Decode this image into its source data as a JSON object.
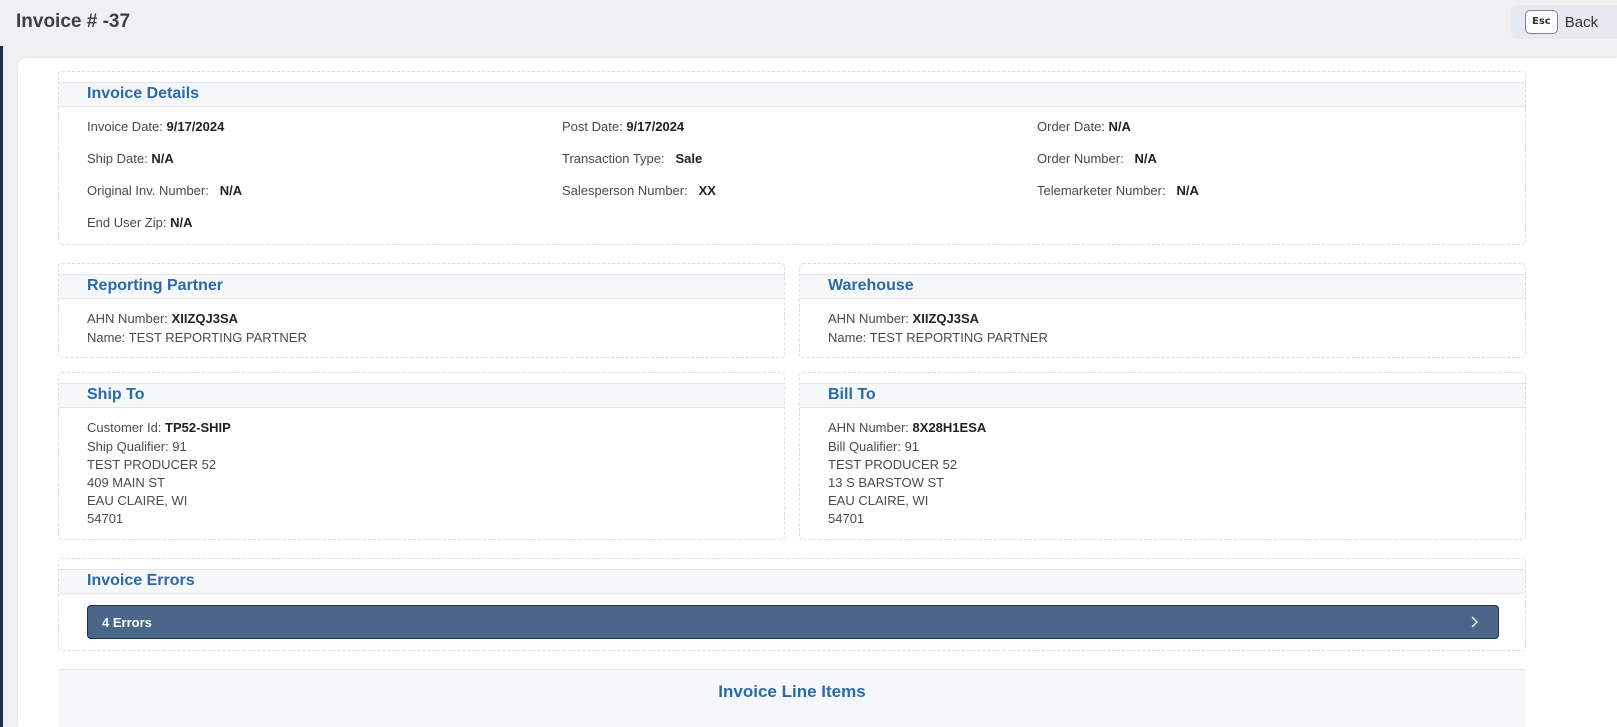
{
  "header": {
    "title": "Invoice # -37",
    "back_key": "Esc",
    "back_label": "Back"
  },
  "invoice_details": {
    "title": "Invoice Details",
    "fields": [
      {
        "label": "Invoice Date:",
        "value": "9/17/2024"
      },
      {
        "label": "Post Date:",
        "value": "9/17/2024"
      },
      {
        "label": "Order Date:",
        "value": "N/A"
      },
      {
        "label": "Ship Date:",
        "value": "N/A"
      },
      {
        "label": "Transaction Type:",
        "value": "Sale"
      },
      {
        "label": "Order Number:",
        "value": "N/A"
      },
      {
        "label": "Original Inv. Number:",
        "value": "N/A"
      },
      {
        "label": "Salesperson Number:",
        "value": "XX"
      },
      {
        "label": "Telemarketer Number:",
        "value": "N/A"
      },
      {
        "label": "End User Zip:",
        "value": "N/A"
      }
    ]
  },
  "reporting_partner": {
    "title": "Reporting Partner",
    "ahn_label": "AHN Number:",
    "ahn_value": "XIIZQJ3SA",
    "name_line": "Name: TEST REPORTING PARTNER"
  },
  "warehouse": {
    "title": "Warehouse",
    "ahn_label": "AHN Number:",
    "ahn_value": "XIIZQJ3SA",
    "name_line": "Name: TEST REPORTING PARTNER"
  },
  "ship_to": {
    "title": "Ship To",
    "id_label": "Customer Id:",
    "id_value": "TP52-SHIP",
    "lines": [
      "Ship Qualifier: 91",
      "TEST PRODUCER 52",
      "409 MAIN ST",
      "EAU CLAIRE, WI",
      "54701"
    ]
  },
  "bill_to": {
    "title": "Bill To",
    "id_label": "AHN Number:",
    "id_value": "8X28H1ESA",
    "lines": [
      "Bill Qualifier: 91",
      "TEST PRODUCER 52",
      "13 S BARSTOW ST",
      "EAU CLAIRE, WI",
      "54701"
    ]
  },
  "invoice_errors": {
    "title": "Invoice Errors",
    "summary": "4 Errors"
  },
  "line_items": {
    "title": "Invoice Line Items"
  },
  "colors": {
    "accent": "#2a6aa8",
    "errors_bar": "#4a6688",
    "sidebar": "#1e2b4a"
  }
}
